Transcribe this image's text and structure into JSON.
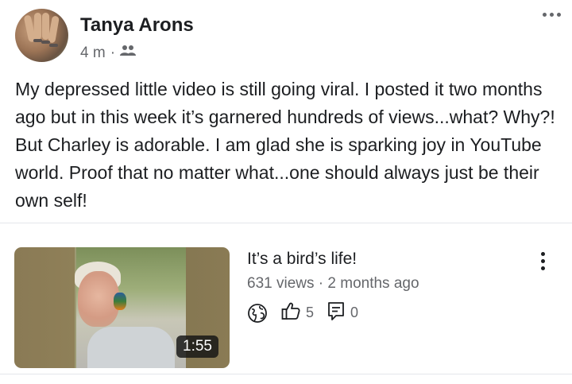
{
  "post": {
    "author": "Tanya Arons",
    "time": "4 m",
    "separator": "·",
    "audience_icon": "friends-icon",
    "more_icon": "more-horizontal-icon",
    "text": "My depressed little video is still going viral.  I posted it two months ago but in this week it’s garnered hundreds of views...what? Why?! But Charley is adorable. I am glad she is sparking joy in YouTube world.  Proof that no matter what...one should always  just be their own self!"
  },
  "video": {
    "title": "It’s a bird’s life!",
    "views": "631 views",
    "separator": "·",
    "age": "2 months ago",
    "duration": "1:55",
    "likes": "5",
    "comments": "0",
    "icons": [
      "globe-icon",
      "thumbs-up-icon",
      "comment-icon",
      "more-vertical-icon"
    ]
  }
}
